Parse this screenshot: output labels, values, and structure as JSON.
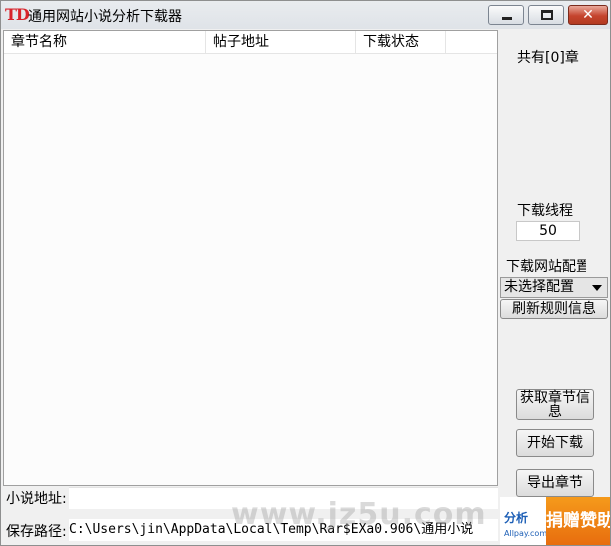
{
  "window": {
    "icon_text": "TD",
    "title": "通用网站小说分析下载器",
    "min_glyph": "",
    "max_glyph": "",
    "close_glyph": "✕"
  },
  "list": {
    "columns": [
      "章节名称",
      "帖子地址",
      "下载状态"
    ],
    "rows": []
  },
  "side": {
    "count_label": "共有[0]章",
    "threads_label": "下载线程",
    "threads_value": "50",
    "site_config_label": "下载网站配置",
    "site_config_selected": "未选择配置",
    "refresh_button": "刷新规则信息",
    "fetch_button": "获取章节信息",
    "start_button": "开始下载",
    "export_button": "导出章节"
  },
  "bottom": {
    "url_label": "小说地址:",
    "url_value": "",
    "path_label": "保存路径:",
    "path_value": "C:\\Users\\jin\\AppData\\Local\\Temp\\Rar$EXa0.906\\通用小说"
  },
  "overlay": {
    "watermark": "www.jz5u.com",
    "logo_top": "分析",
    "logo_bottom": "Allpay.com",
    "banner": "捐赠赞助"
  }
}
